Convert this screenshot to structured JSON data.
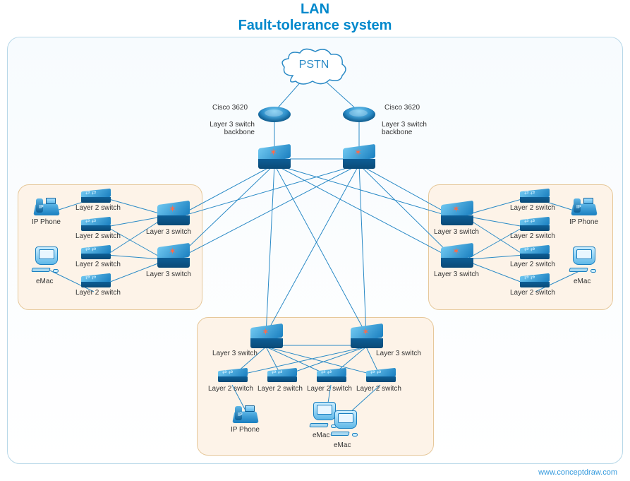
{
  "title": "LAN",
  "subtitle": "Fault-tolerance system",
  "watermark": "www.conceptdraw.com",
  "nodes": {
    "pstn": "PSTN",
    "router_a": "Cisco 3620",
    "router_b": "Cisco 3620",
    "backbone_a": "Layer 3 switch\nbackbone",
    "backbone_b": "Layer 3 switch\nbackbone",
    "left": {
      "phone": "IP Phone",
      "emac": "eMac",
      "l2_1": "Layer 2 switch",
      "l2_2": "Layer 2 switch",
      "l2_3": "Layer 2 switch",
      "l2_4": "Layer 2 switch",
      "l3_1": "Layer 3 switch",
      "l3_2": "Layer 3 switch"
    },
    "right": {
      "phone": "IP Phone",
      "emac": "eMac",
      "l2_1": "Layer 2 switch",
      "l2_2": "Layer 2 switch",
      "l2_3": "Layer 2 switch",
      "l2_4": "Layer 2 switch",
      "l3_1": "Layer 3 switch",
      "l3_2": "Layer 3 switch"
    },
    "bottom": {
      "l3_1": "Layer 3 switch",
      "l3_2": "Layer 3 switch",
      "l2_1": "Layer 2 switch",
      "l2_2": "Layer 2 switch",
      "l2_3": "Layer 2 switch",
      "l2_4": "Layer 2 switch",
      "phone": "IP Phone",
      "emac1": "eMac",
      "emac2": "eMac"
    }
  }
}
